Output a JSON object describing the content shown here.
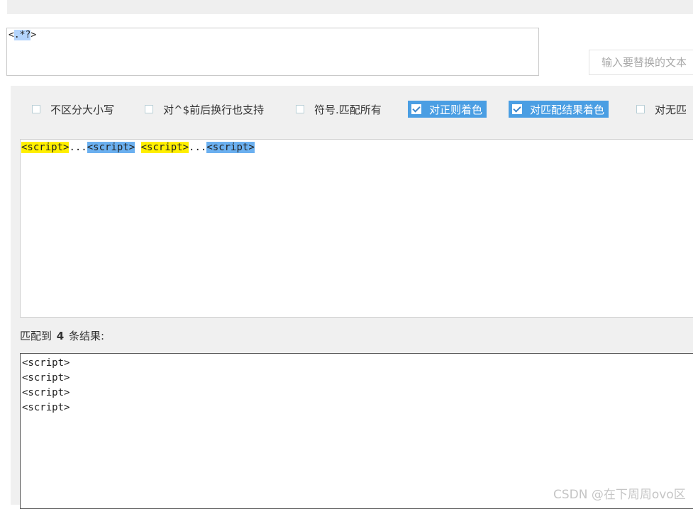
{
  "regex": {
    "prefix": "<",
    "selected": ".*?",
    "suffix": ">"
  },
  "replace": {
    "placeholder": "输入要替换的文本"
  },
  "options": [
    {
      "label": "不区分大小写",
      "checked": false
    },
    {
      "label": "对^$前后换行也支持",
      "checked": false
    },
    {
      "label": "符号.匹配所有",
      "checked": false
    },
    {
      "label": "对正则着色",
      "checked": true
    },
    {
      "label": "对匹配结果着色",
      "checked": true
    },
    {
      "label": "对无匹",
      "checked": false
    }
  ],
  "source": {
    "segments": [
      {
        "text": "<script>",
        "style": "yellow"
      },
      {
        "text": "...",
        "style": "plain"
      },
      {
        "text": "<script>",
        "style": "blue"
      },
      {
        "text": " ",
        "style": "plain"
      },
      {
        "text": "<script>",
        "style": "yellow"
      },
      {
        "text": "...",
        "style": "plain"
      },
      {
        "text": "<script>",
        "style": "blue"
      }
    ]
  },
  "result": {
    "prefix": "匹配到",
    "count": "4",
    "suffix": "条结果:",
    "lines": [
      "<script>",
      "<script>",
      "<script>",
      "<script>"
    ]
  },
  "watermark": "CSDN @在下周周ovo区",
  "colors": {
    "accent": "#4a9ee3",
    "highlight_yellow": "#ffef00",
    "highlight_blue": "#6bb0f0",
    "panel_bg": "#f0f0f0"
  }
}
